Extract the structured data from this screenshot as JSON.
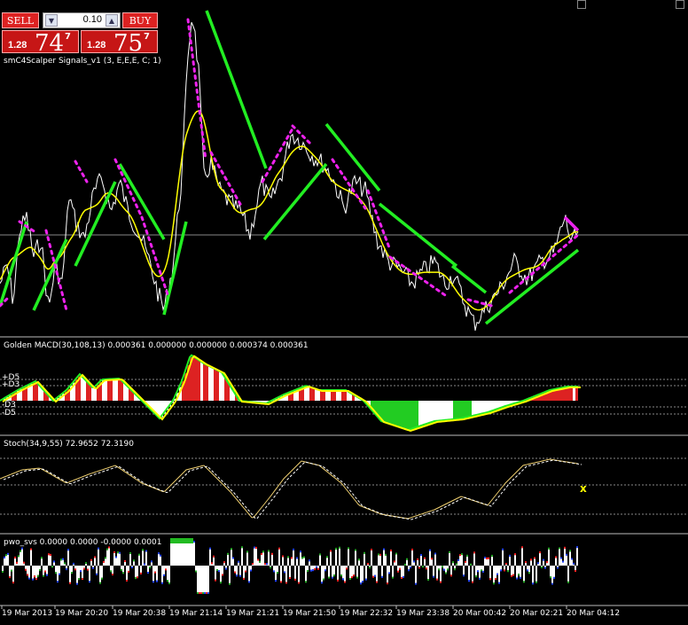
{
  "trade": {
    "sell_label": "SELL",
    "buy_label": "BUY",
    "lot": "0.10",
    "sell_price_small": "1.28",
    "sell_price_big": "74",
    "sell_price_sup": "7",
    "buy_price_small": "1.28",
    "buy_price_big": "75",
    "buy_price_sup": "7"
  },
  "panels": {
    "main": {
      "label": "smC4Scalper Signals_v1 (3, E,E,E, C; 1)"
    },
    "macd": {
      "label": "Golden MACD(30,108,13) 0.000361 0.000000 0.000000 0.000374 0.000361",
      "levels": [
        "+D5",
        "+D3",
        "-D3",
        "-D5"
      ]
    },
    "stoch": {
      "label": "Stoch(34,9,55) 72.9652 72.3190",
      "marker": "x"
    },
    "pwo": {
      "label": "pwo_svs 0.0000 0.0000 -0.0000 0.0001"
    }
  },
  "time_axis": [
    "19 Mar 2013",
    "19 Mar 20:20",
    "19 Mar 20:38",
    "19 Mar 21:14",
    "19 Mar 21:21",
    "19 Mar 21:50",
    "19 Mar 22:32",
    "19 Mar 23:38",
    "20 Mar 00:42",
    "20 Mar 02:21",
    "20 Mar 04:12"
  ],
  "colors": {
    "background": "#000000",
    "price_line": "#ffffff",
    "ma_line": "#ffff00",
    "bull_signal": "#22ee22",
    "bear_signal": "#ee22ee",
    "hist_red": "#dd2222",
    "hist_green": "#22cc22",
    "hist_white": "#ffffff",
    "trade_button": "#dd2222"
  }
}
